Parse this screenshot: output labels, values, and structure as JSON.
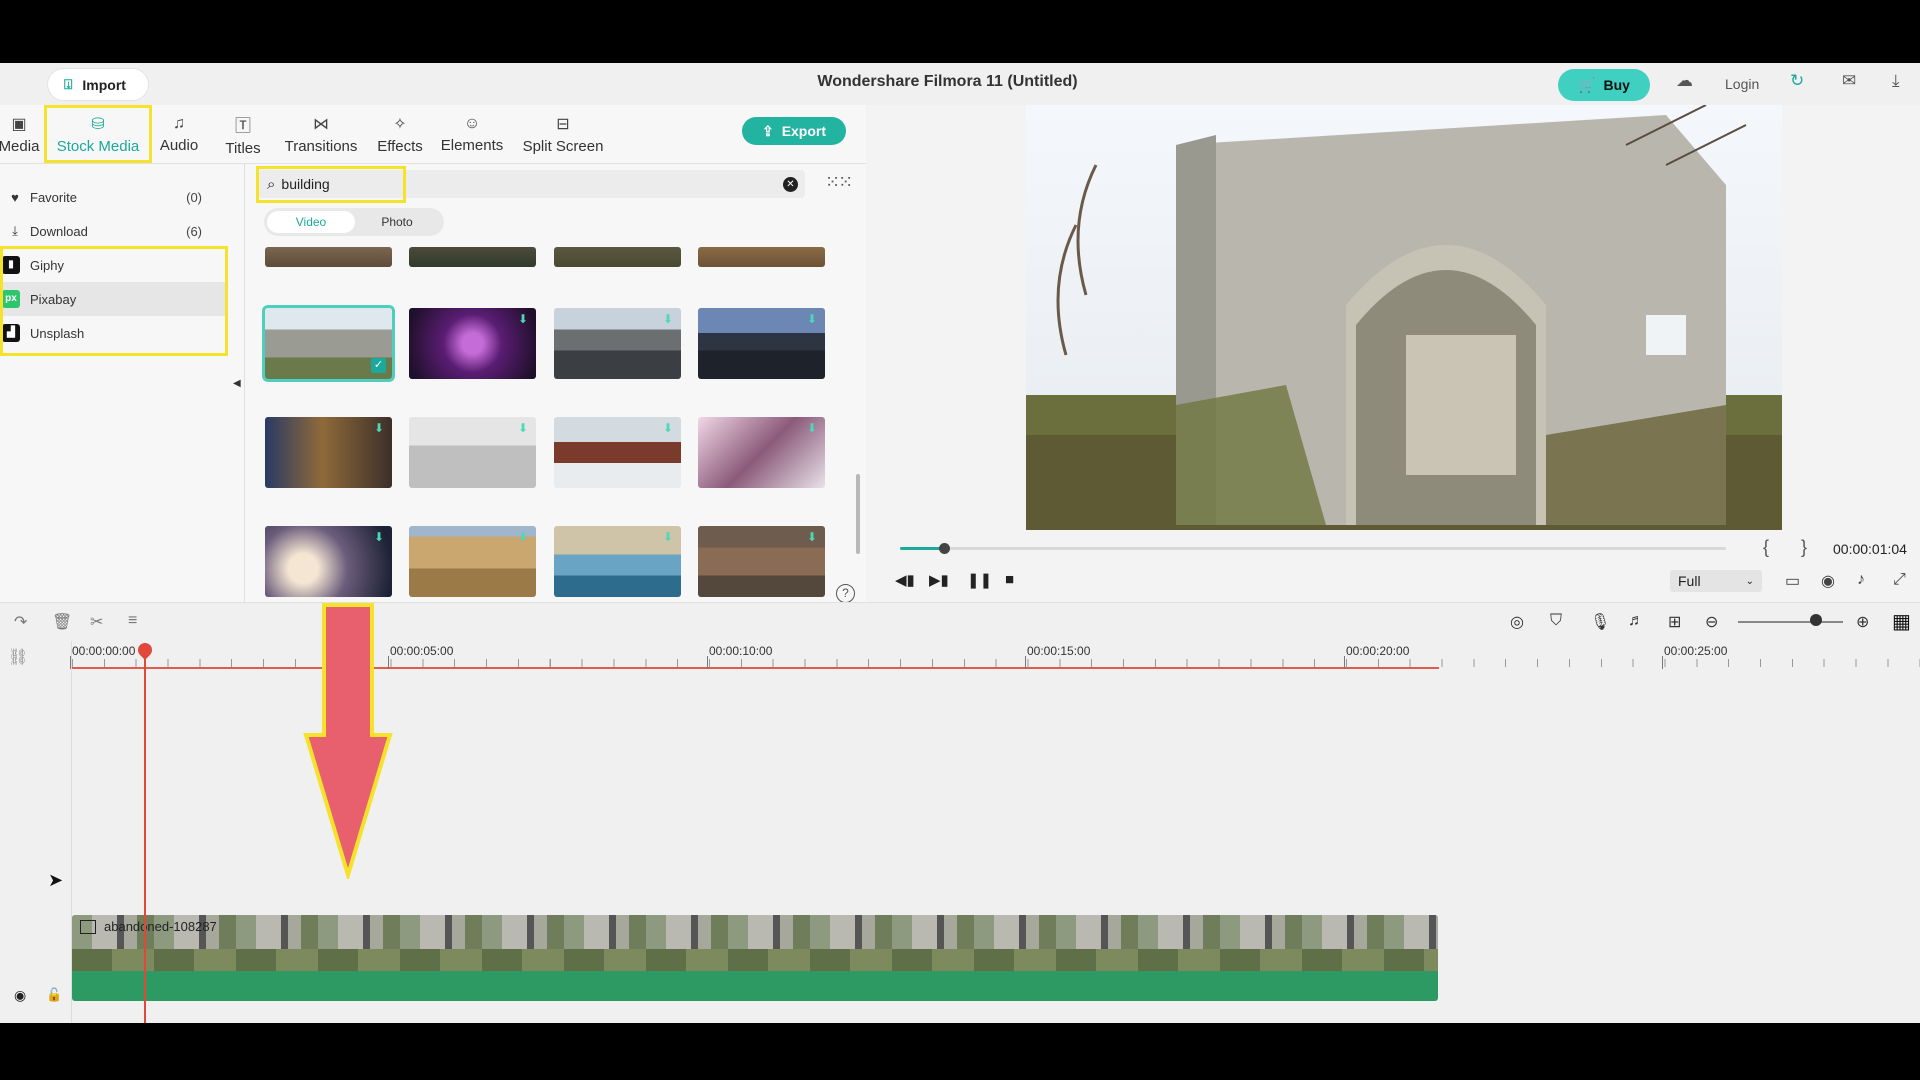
{
  "titlebar": {
    "import_label": "Import",
    "title": "Wondershare Filmora 11 (Untitled)",
    "buy_label": "Buy",
    "login_label": "Login"
  },
  "tabs": [
    {
      "label": "Media",
      "icon": "media-icon"
    },
    {
      "label": "Stock Media",
      "icon": "stock-media-icon",
      "active": true
    },
    {
      "label": "Audio",
      "icon": "music-note-icon"
    },
    {
      "label": "Titles",
      "icon": "titles-icon"
    },
    {
      "label": "Transitions",
      "icon": "transitions-icon"
    },
    {
      "label": "Effects",
      "icon": "effects-icon"
    },
    {
      "label": "Elements",
      "icon": "elements-icon"
    },
    {
      "label": "Split Screen",
      "icon": "split-screen-icon"
    }
  ],
  "export_label": "Export",
  "sidebar": {
    "items": [
      {
        "label": "Favorite",
        "count": "(0)",
        "icon": "heart-icon"
      },
      {
        "label": "Download",
        "count": "(6)",
        "icon": "download-icon"
      },
      {
        "label": "Giphy",
        "icon": "giphy-logo-icon"
      },
      {
        "label": "Pixabay",
        "icon": "pixabay-logo-icon",
        "selected": true
      },
      {
        "label": "Unsplash",
        "icon": "unsplash-logo-icon"
      }
    ]
  },
  "search": {
    "value": "building"
  },
  "media_type": {
    "video": "Video",
    "photo": "Photo",
    "selected": "Video"
  },
  "preview": {
    "timecode": "00:00:01:04",
    "quality": "Full",
    "playback_progress": 0.053
  },
  "timeline": {
    "ruler_labels": [
      "00:00:00:00",
      "00:00:05:00",
      "00:00:10:00",
      "00:00:15:00",
      "00:00:20:00",
      "00:00:25:00"
    ],
    "clip_label": "abandoned-108287"
  },
  "colors": {
    "accent": "#1aa99a",
    "buy": "#3fd0c2",
    "highlight": "#f5e22a",
    "playhead": "#e0483c",
    "clip": "#2d9a64"
  }
}
